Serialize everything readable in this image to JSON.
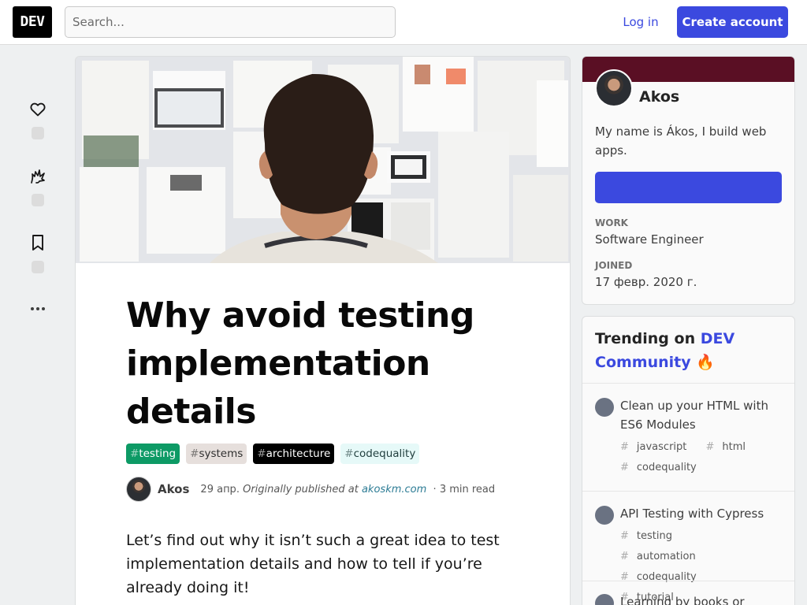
{
  "header": {
    "logo_text": "DEV",
    "search_placeholder": "Search...",
    "login_label": "Log in",
    "create_account_label": "Create account"
  },
  "reactions": {
    "icons": [
      "heart-icon",
      "unicorn-icon",
      "bookmark-icon",
      "more-icon"
    ]
  },
  "article": {
    "title": "Why avoid testing implementation details",
    "tags": [
      {
        "hash": "#",
        "name": "testing",
        "bg": "#0d9a65",
        "fg": "#ffffff"
      },
      {
        "hash": "#",
        "name": "systems",
        "bg": "#e6dfdc",
        "fg": "#2f2f2f"
      },
      {
        "hash": "#",
        "name": "architecture",
        "bg": "#000000",
        "fg": "#ffffff"
      },
      {
        "hash": "#",
        "name": "codequality",
        "bg": "#e6f9f8",
        "fg": "#1f3d3c"
      }
    ],
    "author": "Akos",
    "date": "29 апр.",
    "originally_published": "Originally published at",
    "source_link": "akoskm.com",
    "read_time": "3 min read",
    "intro": "Let’s find out why it isn’t such a great idea to test implementation details and how to tell if you’re already doing it!"
  },
  "profile": {
    "name": "Akos",
    "bio": "My name is Ákos, I build web apps.",
    "work_label": "WORK",
    "work_value": "Software Engineer",
    "joined_label": "JOINED",
    "joined_value": "17 февр. 2020 г.",
    "brand_color": "#5a0f24"
  },
  "trending": {
    "heading_prefix": "Trending on",
    "heading_link": "DEV Community",
    "emoji": "🔥",
    "items": [
      {
        "title": "Clean up your HTML with ES6 Modules",
        "tags": [
          "javascript",
          "html",
          "codequality"
        ]
      },
      {
        "title": "API Testing with Cypress",
        "tags": [
          "testing",
          "automation",
          "codequality",
          "tutorial"
        ]
      },
      {
        "title": "Learning by books or",
        "tags": []
      }
    ]
  },
  "colors": {
    "accent": "#3b49df",
    "page_bg": "#eef0f1"
  }
}
